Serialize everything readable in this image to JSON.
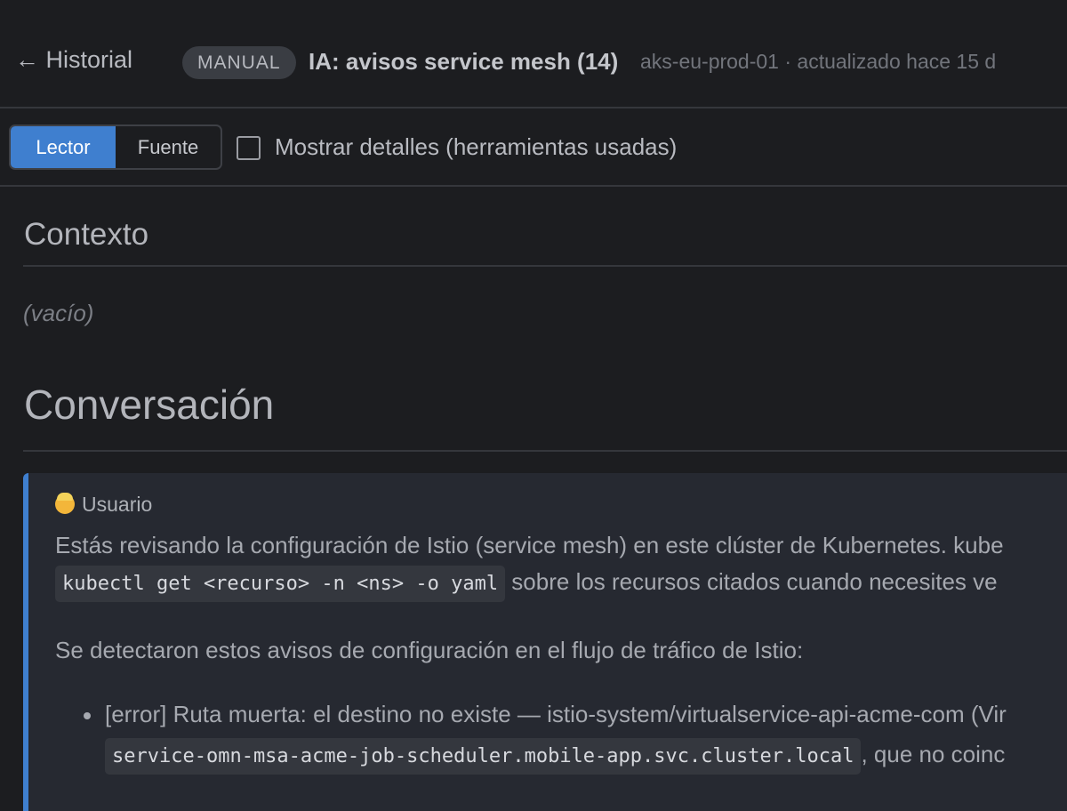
{
  "header": {
    "back_label": "← Historial",
    "badge": "MANUAL",
    "title": "IA: avisos service mesh (14)",
    "meta": "aks-eu-prod-01 · actualizado hace 15 d"
  },
  "toolbar": {
    "view_tabs": [
      {
        "label": "Lector",
        "active": true
      },
      {
        "label": "Fuente",
        "active": false
      }
    ],
    "show_details_label": "Mostrar detalles (herramientas usadas)",
    "show_details_checked": false
  },
  "context": {
    "heading": "Contexto",
    "empty_text": "(vacío)"
  },
  "conversation": {
    "heading": "Conversación",
    "message": {
      "role": "Usuario",
      "line1": "Estás revisando la configuración de Istio (service mesh) en este clúster de Kubernetes. kube",
      "code1": "kubectl get <recurso> -n <ns> -o yaml",
      "line2_rest": " sobre los recursos citados cuando necesites ve",
      "line3": "Se detectaron estos avisos de configuración en el flujo de tráfico de Istio:",
      "bullets": [
        {
          "text": "[error] Ruta muerta: el destino no existe — istio-system/virtualservice-api-acme-com (Vir",
          "code": "service-omn-msa-acme-job-scheduler.mobile-app.svc.cluster.local",
          "rest": ", que no coinc"
        }
      ]
    }
  },
  "colors": {
    "background": "#1c1d20",
    "accent": "#3f7fcf",
    "message_bg": "#262931"
  }
}
